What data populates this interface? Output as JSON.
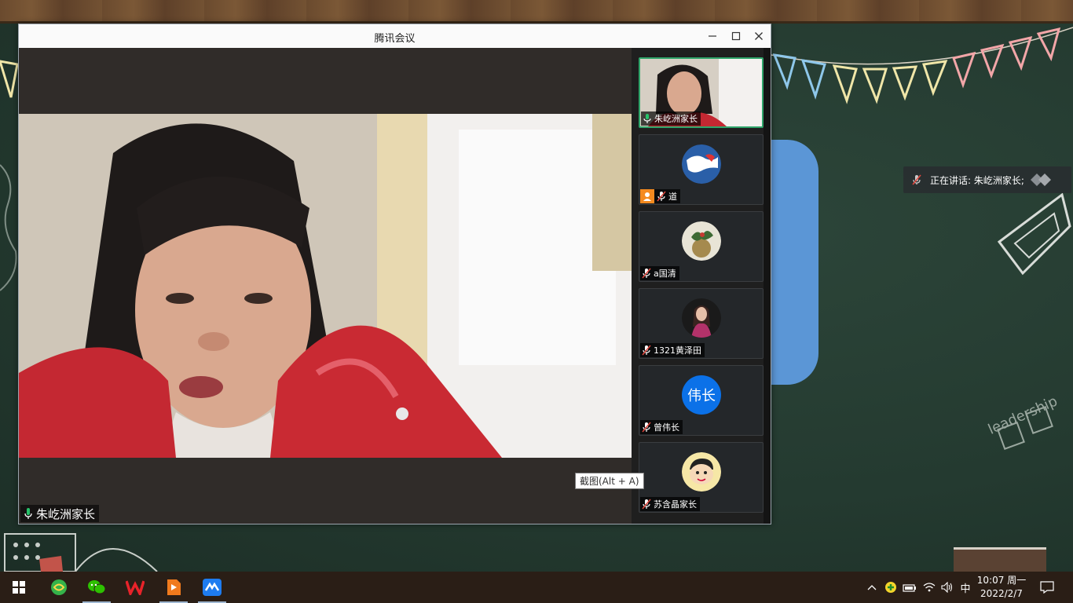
{
  "window": {
    "title": "腾讯会议"
  },
  "main_video": {
    "speaker_name": "朱屹洲家长"
  },
  "participants": [
    {
      "name": "朱屹洲家长",
      "muted": false,
      "active": true
    },
    {
      "name": "道",
      "muted": true,
      "host": true
    },
    {
      "name": "a国清",
      "muted": true
    },
    {
      "name": "1321黄泽田",
      "muted": true
    },
    {
      "name": "曾伟长",
      "muted": true,
      "avatar_text": "伟长"
    },
    {
      "name": "苏含晶家长",
      "muted": true
    }
  ],
  "tooltip": {
    "text": "截图(Alt + A)"
  },
  "speaking_indicator": {
    "text": "正在讲话: 朱屹洲家长;"
  },
  "taskbar": {
    "apps": [
      "windows-start",
      "360-browser",
      "wechat",
      "wps-office",
      "video-player",
      "tencent-meeting"
    ],
    "ime": "中",
    "time": "10:07 周一",
    "date": "2022/2/7"
  },
  "colors": {
    "active_tile_border": "#2fa56a",
    "avatar_blue": "#0b71e8",
    "host_orange": "#f58a1f",
    "wallpaper_green": "#243a30"
  }
}
